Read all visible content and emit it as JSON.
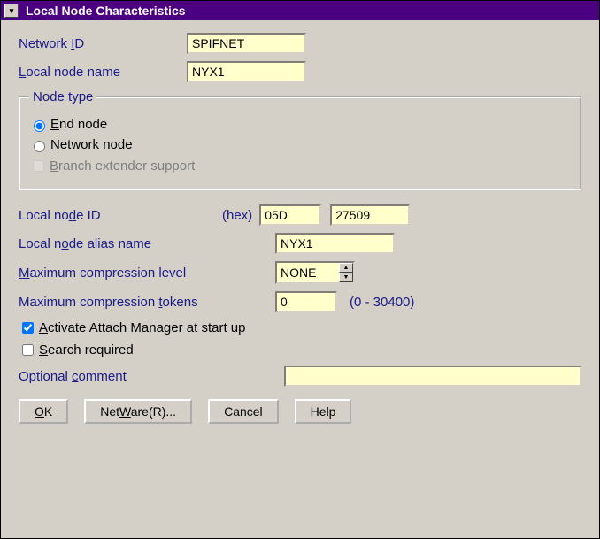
{
  "window": {
    "title": "Local Node Characteristics"
  },
  "fields": {
    "network_id": {
      "label_pre": "Network ",
      "label_u": "I",
      "label_post": "D",
      "value": "SPIFNET"
    },
    "local_node_name": {
      "label_pre": "",
      "label_u": "L",
      "label_post": "ocal node name",
      "value": "NYX1"
    },
    "node_type_legend_pre": "Nod",
    "node_type_legend_u": "e",
    "node_type_legend_post": " type",
    "end_node": {
      "label_u": "E",
      "label_post": "nd node"
    },
    "network_node": {
      "label_u": "N",
      "label_post": "etwork node"
    },
    "branch_ext": {
      "label_u": "B",
      "label_post": "ranch extender support"
    },
    "local_node_id": {
      "label_pre": "Local no",
      "label_u": "d",
      "label_post": "e ID",
      "hex": "(hex)",
      "v1": "05D",
      "v2": "27509"
    },
    "alias": {
      "label_pre": "Local n",
      "label_u": "o",
      "label_post": "de alias name",
      "value": "NYX1"
    },
    "max_comp_level": {
      "label_u": "M",
      "label_post": "aximum compression level",
      "value": "NONE"
    },
    "max_comp_tokens": {
      "label_pre": "Maximum compression ",
      "label_u": "t",
      "label_post": "okens",
      "value": "0",
      "range": "(0 - 30400)"
    },
    "activate_attach": {
      "label_u": "A",
      "label_post": "ctivate Attach Manager at start up"
    },
    "search_req": {
      "label_u": "S",
      "label_post": "earch required"
    },
    "optional_comment": {
      "label_pre": "Optional ",
      "label_u": "c",
      "label_post": "omment",
      "value": ""
    }
  },
  "buttons": {
    "ok_u": "O",
    "ok_post": "K",
    "netware_pre": "Net",
    "netware_u": "W",
    "netware_post": "are(R)...",
    "cancel": "Cancel",
    "help": "Help"
  }
}
